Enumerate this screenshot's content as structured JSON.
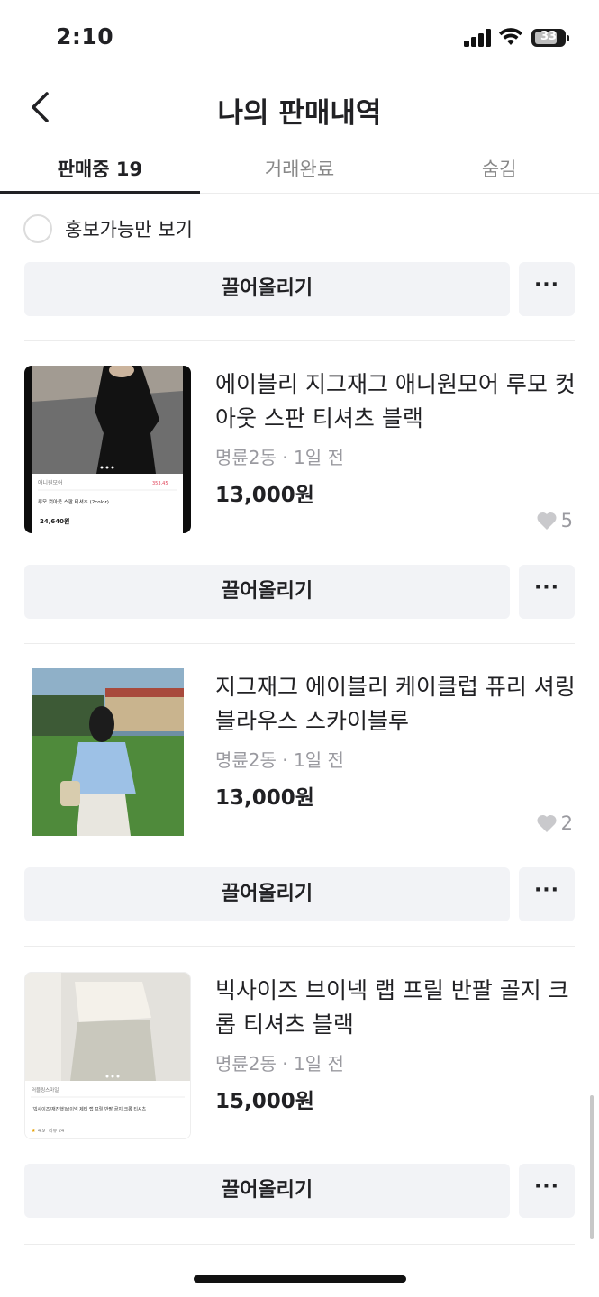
{
  "status_bar": {
    "time": "2:10",
    "battery": "33"
  },
  "header": {
    "title": "나의 판매내역"
  },
  "tabs": [
    {
      "label": "판매중 19",
      "active": true
    },
    {
      "label": "거래완료",
      "active": false
    },
    {
      "label": "숨김",
      "active": false
    }
  ],
  "filter": {
    "label": "홍보가능만 보기"
  },
  "actions": {
    "bump_label": "끌어올리기",
    "more_label": "···"
  },
  "items": [
    {
      "title": "에이블리 지그재그 애니원모어 루모 컷아웃 스판 티셔츠 블랙",
      "meta": "명륜2동 · 1일 전",
      "price": "13,000원",
      "likes": "5",
      "thumb": {
        "shop": "애니원모어",
        "likes": "353,45",
        "name": "루모 컷아웃 스판 티셔츠 (2color)",
        "price": "24,640원"
      }
    },
    {
      "title": "지그재그 에이블리 케이클럽 퓨리 셔링 블라우스 스카이블루",
      "meta": "명륜2동 · 1일 전",
      "price": "13,000원",
      "likes": "2"
    },
    {
      "title": "빅사이즈 브이넥 랩 프릴 반팔 골지 크롭 티셔츠 블랙",
      "meta": "명륜2동 · 1일 전",
      "price": "15,000원",
      "likes": "",
      "thumb": {
        "shop": "러블링스마일",
        "name": "[빅사이즈/재진행]브이넥 제티 랩 프릴 반팔 골지 크롭 티셔츠",
        "rating": "4.9",
        "reviews": "리뷰 24"
      }
    }
  ],
  "colors": {
    "text": "#212124",
    "muted": "#9a9aa0",
    "button_bg": "#f2f3f6",
    "divider": "#ececec"
  }
}
